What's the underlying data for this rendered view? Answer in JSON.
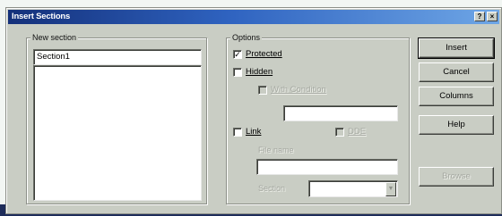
{
  "window": {
    "title": "Insert Sections"
  },
  "title_buttons": {
    "help_glyph": "?",
    "close_glyph": "×"
  },
  "new_section": {
    "group_label": "New section",
    "name_value": "Section1"
  },
  "options": {
    "group_label": "Options",
    "protected_label": "Protected",
    "protected_checked": true,
    "hidden_label": "Hidden",
    "hidden_checked": false,
    "with_condition_label": "With Condition",
    "link_label": "Link",
    "link_checked": false,
    "dde_label": "DDE",
    "filename_label": "File name",
    "section_label": "Section"
  },
  "buttons": {
    "insert": "Insert",
    "cancel": "Cancel",
    "columns": "Columns",
    "help": "Help",
    "browse": "Browse"
  },
  "icons": {
    "check_glyph": "✓",
    "combo_arrow": "▼"
  }
}
